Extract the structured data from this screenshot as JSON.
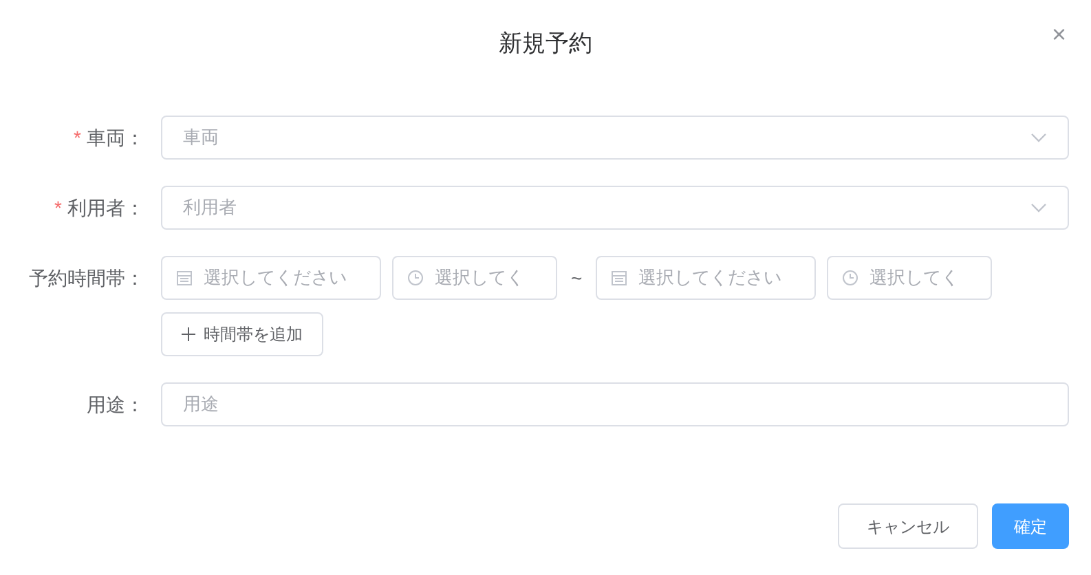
{
  "dialog": {
    "title": "新規予約",
    "close": "×"
  },
  "fields": [
    {
      "kind": "select",
      "label": "車両：",
      "required": true,
      "placeholder": "車両"
    },
    {
      "kind": "select",
      "label": "利用者：",
      "required": true,
      "placeholder": "利用者"
    },
    {
      "kind": "time_range",
      "label": "予約時間帯：",
      "required": false,
      "start_date": "選択してください",
      "start_time": "選択してく",
      "separator": "~",
      "end_date": "選択してください",
      "end_time": "選択してく",
      "add_button": "時間帯を追加"
    },
    {
      "kind": "input",
      "label": "用途：",
      "required": false,
      "placeholder": "用途"
    }
  ],
  "required_mark": "*",
  "buttons": [
    {
      "label": "キャンセル",
      "primary": false
    },
    {
      "label": "確定",
      "primary": true
    }
  ]
}
